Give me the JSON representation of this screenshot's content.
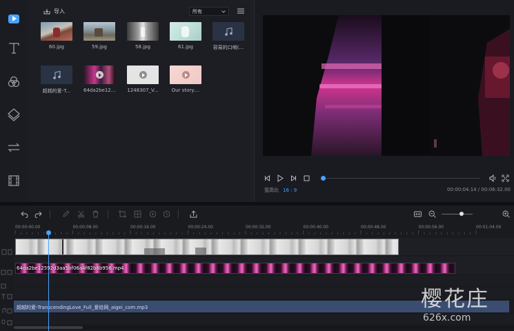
{
  "library": {
    "import_label": "导入",
    "filter_value": "所有",
    "items": [
      {
        "label": "60.jpg"
      },
      {
        "label": "59.jpg"
      },
      {
        "label": "58.jpg"
      },
      {
        "label": "61.jpg"
      },
      {
        "label": "容易的口哨(..."
      },
      {
        "label": "超越的爱-T..."
      },
      {
        "label": "64da2be12..."
      },
      {
        "label": "1248307_V..."
      },
      {
        "label": "Our story...."
      }
    ]
  },
  "preview": {
    "ratio_label": "宽高比",
    "ratio_value": "16 : 9",
    "timecode": "00:00:04.14 / 00:06:32.00",
    "progress": 0.009
  },
  "timeline": {
    "ruler": [
      "00:00:00.00",
      "00:00:08.00",
      "00:00:16.00",
      "00:00:24.00",
      "00:00:32.00",
      "00:00:40.00",
      "00:00:48.00",
      "00:00:56.00",
      "00:01:04.00"
    ],
    "video_clip_label": "64da2be12592d3aa5bf06a4f82b8b956.mp4",
    "audio_clip_label": "超越的爱-TranscendingLove_Full_爱给网_aigei_com.mp3"
  },
  "watermark": {
    "main": "樱花庄",
    "sub": "626x.com"
  },
  "colors": {
    "accent": "#4aa2ff",
    "audio_clip": "#3a4d71"
  }
}
